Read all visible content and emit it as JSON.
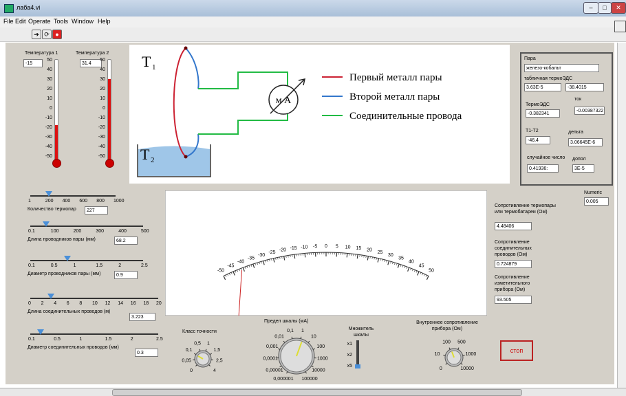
{
  "window": {
    "title": "лаба4.vi"
  },
  "menu": [
    "File",
    "Edit",
    "Operate",
    "Tools",
    "Window",
    "Help"
  ],
  "thermo1": {
    "label": "Температура 1",
    "value": "-15",
    "scale": [
      "50",
      "40",
      "30",
      "20",
      "10",
      "0",
      "-10",
      "-20",
      "-30",
      "-40",
      "-50"
    ],
    "level": 0.35
  },
  "thermo2": {
    "label": "Температура 2",
    "value": "31.4",
    "scale": [
      "50",
      "40",
      "30",
      "20",
      "10",
      "0",
      "-10",
      "-20",
      "-30",
      "-40",
      "-50"
    ],
    "level": 0.81
  },
  "diagram": {
    "t1": "T",
    "t1sub": "1",
    "t2": "T",
    "t2sub": "2",
    "meter": "м А",
    "legend": [
      "Первый металл пары",
      "Второй металл пары",
      "Соединительные провода"
    ],
    "colors": [
      "#cc2233",
      "#3377cc",
      "#22bb44"
    ]
  },
  "right": {
    "pair_label": "Пара",
    "pair_value": "железо-кобальт",
    "table_emf_label": "табличная термоЭДС",
    "table_emf_1": "3.63E-5",
    "table_emf_2": "-38.4015",
    "emf_label": "ТермоЭДС",
    "emf_value": "-0.382341",
    "current_label": "ток",
    "current_value": "-0.00387322",
    "dt_label": "T1-T2",
    "dt_value": "-46.4",
    "delta_label": "дельта",
    "delta_value": "3.06645E-6",
    "rand_label": "случайное число",
    "rand_value": "0.41936:",
    "dopol_label": "допол",
    "dopol_value": "3E-5"
  },
  "numeric": {
    "label": "Numeric",
    "value": "0.005"
  },
  "resist": {
    "r1_label": "Сопротивление термопары или термобатареи (Ом)",
    "r1_value": "4.48406",
    "r2_label": "Сопротивление соединительных проводов (Ом)",
    "r2_value": "0.724879",
    "r3_label": "Сопротивление изметительного прибора (Ом)",
    "r3_value": "93.505"
  },
  "sliders": [
    {
      "ticks": [
        "1",
        "200",
        "400",
        "600",
        "800",
        "1000"
      ],
      "label": "Количество термопар",
      "value": "227",
      "pos": 0.22
    },
    {
      "ticks": [
        "0.1",
        "100",
        "200",
        "300",
        "400",
        "500"
      ],
      "label": "Длина проводников пары (мм)",
      "value": "68.2",
      "pos": 0.14
    },
    {
      "ticks": [
        "0.1",
        "0.5",
        "1",
        "1.5",
        "2",
        "2.5"
      ],
      "label": "Диаметр проводников пары (мм)",
      "value": "0.9",
      "pos": 0.33
    },
    {
      "ticks": [
        "0",
        "2",
        "4",
        "6",
        "8",
        "10",
        "12",
        "14",
        "16",
        "18",
        "20"
      ],
      "label": "Длина соединительных проводов (м)",
      "value": "3.223",
      "pos": 0.16
    },
    {
      "ticks": [
        "0.1",
        "0.5",
        "1",
        "1.5",
        "2",
        "2.5"
      ],
      "label": "Диаметр соединительных проводов (мм)",
      "value": "0.3",
      "pos": 0.08
    }
  ],
  "gauge": {
    "ticks": [
      "-50",
      "-45",
      "-40",
      "-35",
      "-30",
      "-25",
      "-20",
      "-15",
      "-10",
      "-5",
      "0",
      "5",
      "10",
      "15",
      "20",
      "25",
      "30",
      "35",
      "40",
      "45",
      "50"
    ],
    "needle": -41
  },
  "knobs": {
    "accuracy": {
      "label": "Класс точности",
      "ticks": [
        "0",
        "0,05",
        "0,1",
        "0,5",
        "1",
        "1,5",
        "2,5",
        "4"
      ]
    },
    "range": {
      "label": "Предел шкалы (мА)",
      "ticks": [
        "0,000001",
        "0,00001",
        "0,0001",
        "0,001",
        "0,01",
        "0,1",
        "1",
        "10",
        "100",
        "1000",
        "10000",
        "100000"
      ]
    },
    "mult": {
      "label": "Множитель шкалы",
      "ticks": [
        "x1",
        "x2",
        "x5"
      ]
    },
    "internal": {
      "label": "Внутреннее сопротивление прибора (Ом)",
      "ticks": [
        "0",
        "10",
        "100",
        "500",
        "1000",
        "10000"
      ]
    }
  },
  "stop": {
    "label": "стоп"
  }
}
